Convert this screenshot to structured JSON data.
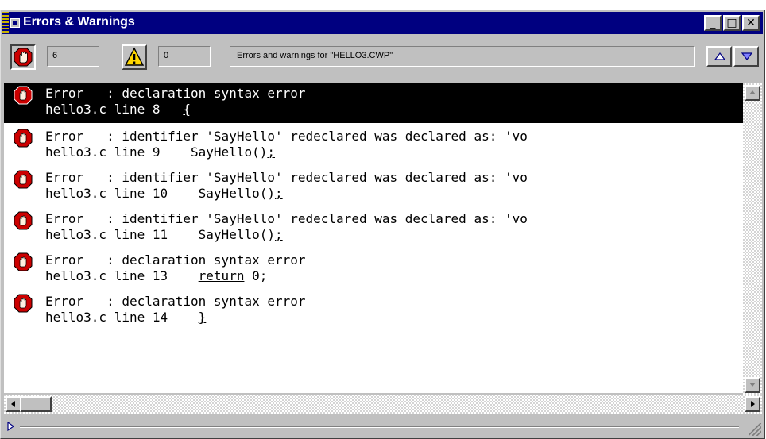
{
  "window": {
    "title": "Errors & Warnings",
    "minimize_label": "_",
    "maximize_label": "□",
    "close_label": "✕"
  },
  "toolbar": {
    "error_count": "6",
    "warning_count": "0",
    "info_text": "Errors and warnings for \"HELLO3.CWP\"",
    "prev_icon": "triangle-up-icon",
    "next_icon": "triangle-down-icon"
  },
  "colors": {
    "titlebar": "#000080",
    "selection": "#000000",
    "error_icon": "#cc0000",
    "warning_icon": "#ffd700"
  },
  "messages": [
    {
      "kind": "Error",
      "line1": "Error   : declaration syntax error",
      "file_line": "hello3.c line 8   ",
      "code": "{",
      "selected": true
    },
    {
      "kind": "Error",
      "line1": "Error   : identifier 'SayHello' redeclared was declared as: 'vo",
      "file_line": "hello3.c line 9    SayHello()",
      "code": ";",
      "selected": false
    },
    {
      "kind": "Error",
      "line1": "Error   : identifier 'SayHello' redeclared was declared as: 'vo",
      "file_line": "hello3.c line 10    SayHello()",
      "code": ";",
      "selected": false
    },
    {
      "kind": "Error",
      "line1": "Error   : identifier 'SayHello' redeclared was declared as: 'vo",
      "file_line": "hello3.c line 11    SayHello()",
      "code": ";",
      "selected": false
    },
    {
      "kind": "Error",
      "line1": "Error   : declaration syntax error",
      "file_line": "hello3.c line 13    ",
      "code": "return",
      "code_suffix": " 0;",
      "selected": false
    },
    {
      "kind": "Error",
      "line1": "Error   : declaration syntax error",
      "file_line": "hello3.c line 14    ",
      "code": "}",
      "selected": false
    }
  ],
  "bottom": {
    "disclosure_icon": "triangle-right-icon"
  }
}
